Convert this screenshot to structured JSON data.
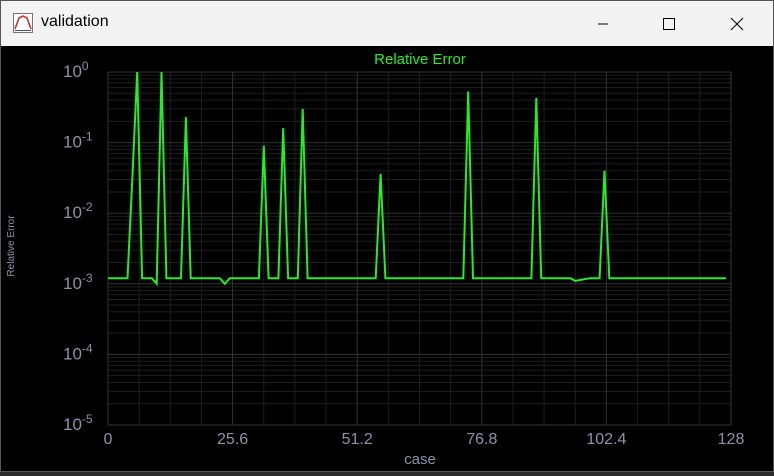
{
  "window": {
    "title": "validation",
    "icon": "app-chart-icon",
    "controls": [
      "minimize-icon",
      "maximize-icon",
      "close-icon"
    ]
  },
  "colors": {
    "background": "#000000",
    "series": "#22ee22",
    "axis_text": "#8a93a8",
    "grid": "#333333"
  },
  "chart_data": {
    "type": "line",
    "title": "Relative Error",
    "xlabel": "case",
    "ylabel": "Relative Error",
    "xlim": [
      0,
      128
    ],
    "ylim": [
      1e-05,
      1
    ],
    "yscale": "log",
    "grid": true,
    "x_ticks": [
      "0",
      "25.6",
      "51.2",
      "76.8",
      "102.4",
      "128"
    ],
    "y_ticks": [
      {
        "base": "10",
        "exp": "0"
      },
      {
        "base": "10",
        "exp": "-1"
      },
      {
        "base": "10",
        "exp": "-2"
      },
      {
        "base": "10",
        "exp": "-3"
      },
      {
        "base": "10",
        "exp": "-4"
      },
      {
        "base": "10",
        "exp": "-5"
      }
    ],
    "series": [
      {
        "x": [
          0,
          4,
          5,
          6,
          7,
          9,
          10,
          11,
          12,
          15,
          16,
          17,
          18,
          23,
          24,
          25,
          31,
          32,
          33,
          35,
          36,
          37,
          39,
          40,
          41,
          43,
          55,
          56,
          57,
          59,
          73,
          74,
          75,
          77,
          87,
          88,
          89,
          91,
          95,
          96,
          99,
          101,
          102,
          103,
          105,
          127
        ],
        "y": [
          0.0012,
          0.0012,
          0.03,
          1.0,
          0.0012,
          0.0012,
          0.001,
          1.0,
          0.0012,
          0.0012,
          0.23,
          0.0012,
          0.0012,
          0.0012,
          0.001,
          0.0012,
          0.0012,
          0.09,
          0.0012,
          0.0012,
          0.16,
          0.0012,
          0.0012,
          0.3,
          0.0012,
          0.0012,
          0.0012,
          0.036,
          0.0012,
          0.0012,
          0.0012,
          0.53,
          0.0012,
          0.0012,
          0.0012,
          0.43,
          0.0012,
          0.0012,
          0.0012,
          0.0011,
          0.0012,
          0.0012,
          0.04,
          0.0012,
          0.0012,
          0.0012
        ]
      }
    ]
  }
}
